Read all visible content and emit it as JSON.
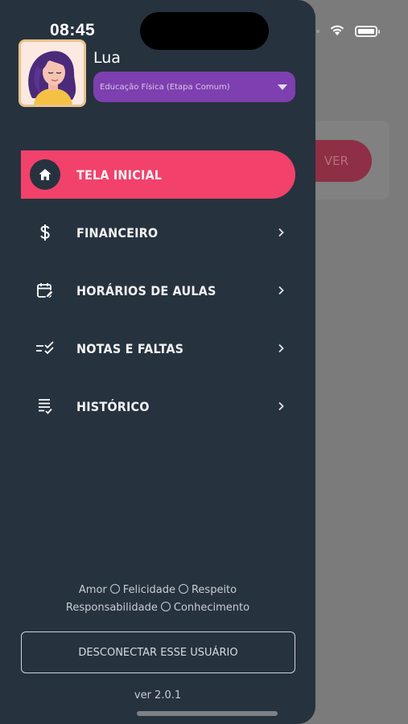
{
  "status_bar": {
    "time": "08:45"
  },
  "background": {
    "ver_button": "VER"
  },
  "profile": {
    "name": "Lua",
    "course_selected": "Educação Física (Etapa Comum)"
  },
  "menu": [
    {
      "label": "TELA INICIAL",
      "icon": "home-icon",
      "active": true
    },
    {
      "label": "FINANCEIRO",
      "icon": "dollar-icon",
      "active": false
    },
    {
      "label": "HORÁRIOS DE AULAS",
      "icon": "calendar-edit-icon",
      "active": false
    },
    {
      "label": "NOTAS E FALTAS",
      "icon": "checklist-icon",
      "active": false
    },
    {
      "label": "HISTÓRICO",
      "icon": "document-list-icon",
      "active": false
    }
  ],
  "values": {
    "line1": [
      "Amor",
      "Felicidade",
      "Respeito"
    ],
    "line2": [
      "Responsabilidade",
      "Conhecimento"
    ]
  },
  "logout_label": "DESCONECTAR ESSE USUÁRIO",
  "version": "ver 2.0.1",
  "colors": {
    "drawer_bg": "#27323f",
    "active_item": "#f2416b",
    "course_select": "#7e3fb0",
    "overlay": "#7b7b7b"
  }
}
